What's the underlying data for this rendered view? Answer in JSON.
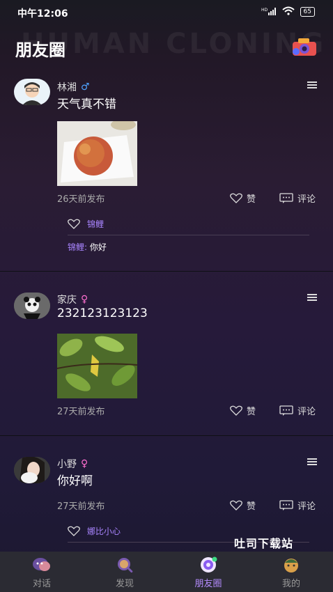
{
  "status_bar": {
    "time": "中午12:06",
    "network": "HD",
    "battery": "65"
  },
  "header": {
    "title": "朋友圈",
    "watermark": "HUMAN CLONING"
  },
  "posts": [
    {
      "user": "林湘",
      "gender": "♂",
      "gender_color": "#4fa3ff",
      "content": "天气真不错",
      "time": "26天前发布",
      "like_label": "赞",
      "comment_label": "评论",
      "likers": "锦鲤",
      "comments": [
        {
          "who": "锦鲤:",
          "text": "你好"
        }
      ]
    },
    {
      "user": "家庆",
      "gender": "♀",
      "gender_color": "#ff6fd0",
      "content": "232123123123",
      "time": "27天前发布",
      "like_label": "赞",
      "comment_label": "评论"
    },
    {
      "user": "小野",
      "gender": "♀",
      "gender_color": "#ff6fd0",
      "content": "你好啊",
      "time": "27天前发布",
      "like_label": "赞",
      "comment_label": "评论",
      "likers": "娜比小心"
    }
  ],
  "brand": "吐司下载站",
  "tabs": [
    {
      "label": "对话"
    },
    {
      "label": "发现"
    },
    {
      "label": "朋友圈"
    },
    {
      "label": "我的"
    }
  ],
  "colors": {
    "accent": "#b58cff",
    "link": "#a985ff"
  }
}
